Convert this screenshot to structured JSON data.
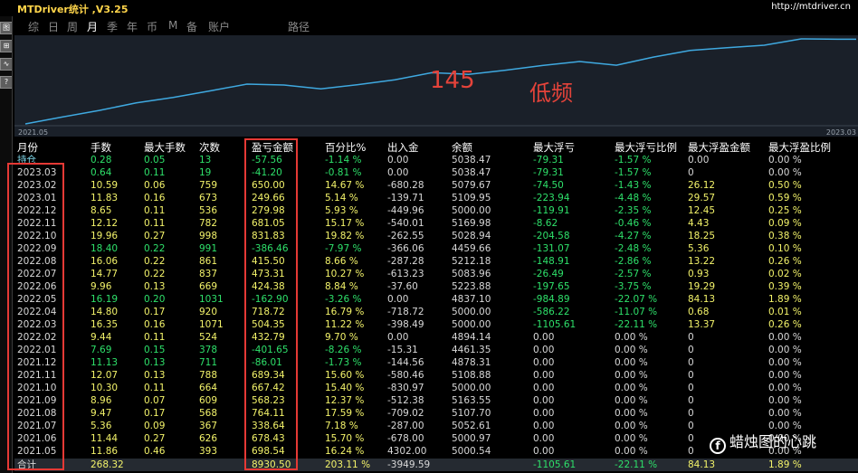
{
  "window": {
    "title": "MTDriver统计 ,V3.25",
    "url": "http://mtdriver.cn"
  },
  "sidebar": {
    "buttons": [
      "图",
      "⊞",
      "∿",
      "?"
    ]
  },
  "menu": [
    {
      "label": "综",
      "active": false
    },
    {
      "label": "日",
      "active": false
    },
    {
      "label": "周",
      "active": false
    },
    {
      "label": "月",
      "active": true
    },
    {
      "label": "季",
      "active": false
    },
    {
      "label": "年",
      "active": false
    },
    {
      "label": "币",
      "active": false
    },
    {
      "label": "M",
      "active": false
    },
    {
      "label": "备",
      "active": false
    },
    {
      "label": "账户",
      "active": false
    },
    {
      "label": "路径",
      "active": false
    }
  ],
  "chart_data": {
    "type": "line",
    "x_start_label": "2021.05",
    "x_end_label": "2023.03",
    "series": [
      {
        "values": [
          0,
          698.54,
          1377.77,
          2141.91,
          2710.14,
          3377.56,
          4066.9,
          3980.84,
          3579.19,
          4012.0,
          4516.35,
          5235.07,
          5072.17,
          5496.55,
          5969.86,
          6385.28,
          6001.81,
          6832.64,
          7513.69,
          7793.67,
          8043.33,
          8693.33,
          8652.12
        ]
      }
    ],
    "grid": false
  },
  "overlay": {
    "big_number": "145",
    "label": "低频"
  },
  "table": {
    "headers": [
      "月份",
      "手数",
      "最大手数",
      "次数",
      "盈亏金额",
      "百分比%",
      "出入金",
      "余额",
      "最大浮亏",
      "最大浮亏比例",
      "最大浮盈金额",
      "最大浮盈比例"
    ],
    "hold_row": [
      "持仓",
      "0.28",
      "0.05",
      "13",
      "-57.56",
      "-1.14 %",
      "0.00",
      "5038.47",
      "-79.31",
      "-1.57 %",
      "0.00",
      "0.00 %"
    ],
    "rows": [
      [
        "2023.03",
        "0.64",
        "0.11",
        "19",
        "-41.20",
        "-0.81 %",
        "0.00",
        "5038.47",
        "-79.31",
        "-1.57 %",
        "0",
        "0.00 %"
      ],
      [
        "2023.02",
        "10.59",
        "0.06",
        "759",
        "650.00",
        "14.67 %",
        "-680.28",
        "5079.67",
        "-74.50",
        "-1.43 %",
        "26.12",
        "0.50 %"
      ],
      [
        "2023.01",
        "11.83",
        "0.16",
        "673",
        "249.66",
        "5.14 %",
        "-139.71",
        "5109.95",
        "-223.94",
        "-4.48 %",
        "29.57",
        "0.59 %"
      ],
      [
        "2022.12",
        "8.65",
        "0.11",
        "536",
        "279.98",
        "5.93 %",
        "-449.96",
        "5000.00",
        "-119.91",
        "-2.35 %",
        "12.45",
        "0.25 %"
      ],
      [
        "2022.11",
        "12.12",
        "0.11",
        "782",
        "681.05",
        "15.17 %",
        "-540.01",
        "5169.98",
        "-8.62",
        "-0.46 %",
        "4.43",
        "0.09 %"
      ],
      [
        "2022.10",
        "19.96",
        "0.27",
        "998",
        "831.83",
        "19.82 %",
        "-262.55",
        "5028.94",
        "-204.58",
        "-4.27 %",
        "18.25",
        "0.38 %"
      ],
      [
        "2022.09",
        "18.40",
        "0.22",
        "991",
        "-386.46",
        "-7.97 %",
        "-366.06",
        "4459.66",
        "-131.07",
        "-2.48 %",
        "5.36",
        "0.10 %"
      ],
      [
        "2022.08",
        "16.06",
        "0.22",
        "861",
        "415.50",
        "8.66 %",
        "-287.28",
        "5212.18",
        "-148.91",
        "-2.86 %",
        "13.22",
        "0.26 %"
      ],
      [
        "2022.07",
        "14.77",
        "0.22",
        "837",
        "473.31",
        "10.27 %",
        "-613.23",
        "5083.96",
        "-26.49",
        "-2.57 %",
        "0.93",
        "0.02 %"
      ],
      [
        "2022.06",
        "9.96",
        "0.13",
        "669",
        "424.38",
        "8.84 %",
        "-37.60",
        "5223.88",
        "-197.65",
        "-3.75 %",
        "19.29",
        "0.39 %"
      ],
      [
        "2022.05",
        "16.19",
        "0.20",
        "1031",
        "-162.90",
        "-3.26 %",
        "0.00",
        "4837.10",
        "-984.89",
        "-22.07 %",
        "84.13",
        "1.89 %"
      ],
      [
        "2022.04",
        "14.80",
        "0.17",
        "920",
        "718.72",
        "16.79 %",
        "-718.72",
        "5000.00",
        "-586.22",
        "-11.07 %",
        "0.68",
        "0.01 %"
      ],
      [
        "2022.03",
        "16.35",
        "0.16",
        "1071",
        "504.35",
        "11.22 %",
        "-398.49",
        "5000.00",
        "-1105.61",
        "-22.11 %",
        "13.37",
        "0.26 %"
      ],
      [
        "2022.02",
        "9.44",
        "0.11",
        "524",
        "432.79",
        "9.70 %",
        "0.00",
        "4894.14",
        "0.00",
        "0.00 %",
        "0",
        "0.00 %"
      ],
      [
        "2022.01",
        "7.69",
        "0.15",
        "378",
        "-401.65",
        "-8.26 %",
        "-15.31",
        "4461.35",
        "0.00",
        "0.00 %",
        "0",
        "0.00 %"
      ],
      [
        "2021.12",
        "11.13",
        "0.13",
        "711",
        "-86.01",
        "-1.73 %",
        "-144.56",
        "4878.31",
        "0.00",
        "0.00 %",
        "0",
        "0.00 %"
      ],
      [
        "2021.11",
        "12.07",
        "0.13",
        "788",
        "689.34",
        "15.60 %",
        "-580.46",
        "5108.88",
        "0.00",
        "0.00 %",
        "0",
        "0.00 %"
      ],
      [
        "2021.10",
        "10.30",
        "0.11",
        "664",
        "667.42",
        "15.40 %",
        "-830.97",
        "5000.00",
        "0.00",
        "0.00 %",
        "0",
        "0.00 %"
      ],
      [
        "2021.09",
        "8.96",
        "0.07",
        "609",
        "568.23",
        "12.37 %",
        "-512.38",
        "5163.55",
        "0.00",
        "0.00 %",
        "0",
        "0.00 %"
      ],
      [
        "2021.08",
        "9.47",
        "0.17",
        "568",
        "764.11",
        "17.59 %",
        "-709.02",
        "5107.70",
        "0.00",
        "0.00 %",
        "0",
        "0.00 %"
      ],
      [
        "2021.07",
        "5.36",
        "0.09",
        "367",
        "338.64",
        "7.18 %",
        "-287.00",
        "5052.61",
        "0.00",
        "0.00 %",
        "0",
        "0.00 %"
      ],
      [
        "2021.06",
        "11.44",
        "0.27",
        "626",
        "678.43",
        "15.70 %",
        "-678.00",
        "5000.97",
        "0.00",
        "0.00 %",
        "0",
        "0.00 %"
      ],
      [
        "2021.05",
        "11.86",
        "0.46",
        "393",
        "698.54",
        "16.24 %",
        "4302.00",
        "5000.54",
        "0.00",
        "0.00 %",
        "0",
        "0.00 %"
      ]
    ],
    "total_row": [
      "合计",
      "268.32",
      "",
      "",
      "8930.50",
      "203.11 %",
      "-3949.59",
      "",
      "-1105.61",
      "-22.11 %",
      "84.13",
      "1.89 %"
    ]
  },
  "watermark": "蜡烛图的心跳",
  "colors": {
    "accent_line": "#3fa9e0",
    "positive": "#f3f36a",
    "negative": "#2ee06a",
    "highlight": "#e53935"
  }
}
